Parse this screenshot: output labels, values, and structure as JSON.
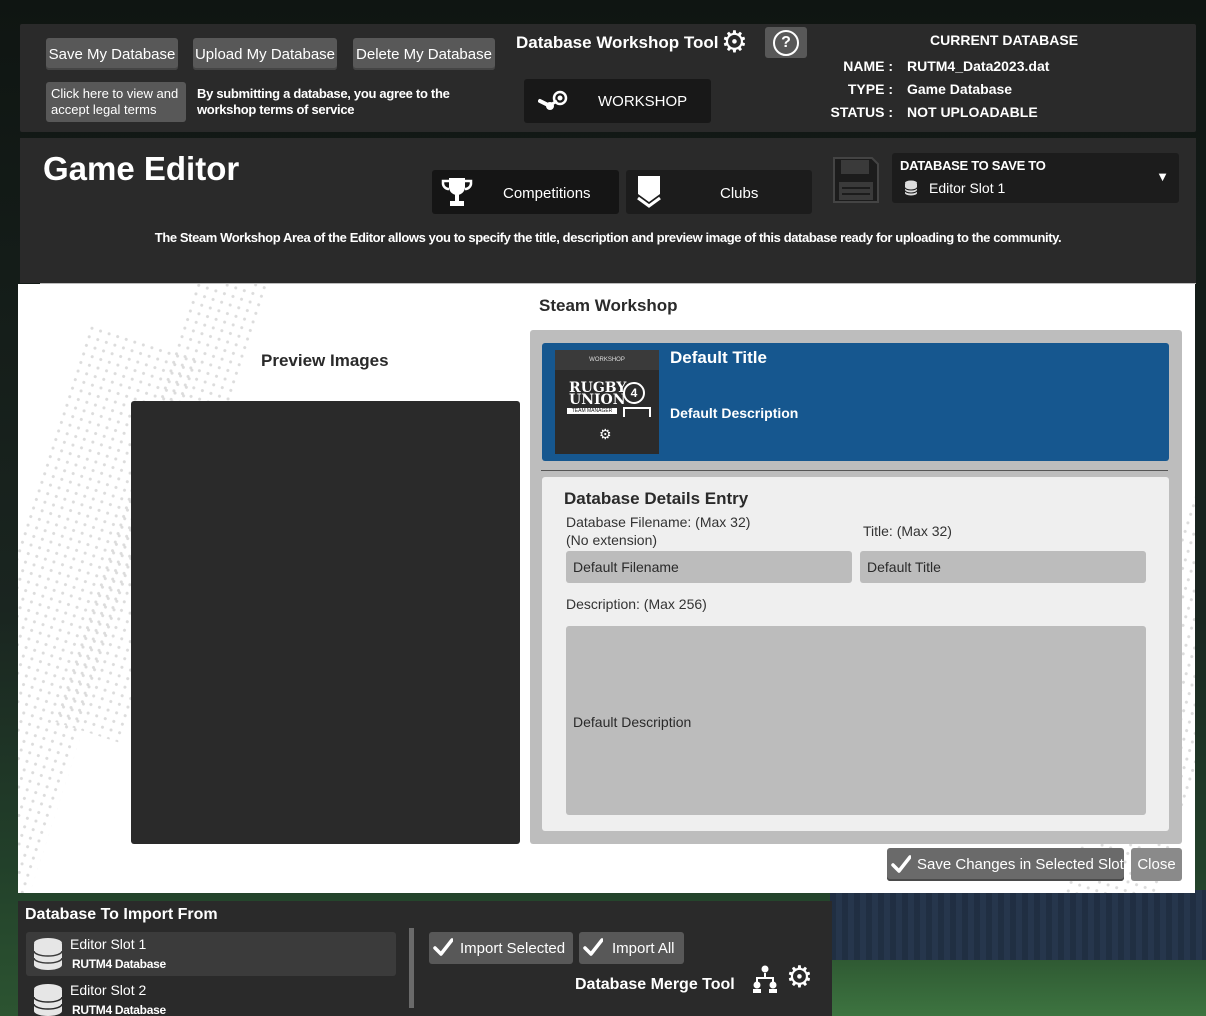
{
  "toolbar": {
    "save_label": "Save My Database",
    "upload_label": "Upload My Database",
    "delete_label": "Delete My Database",
    "legal_button": "Click here to view and accept legal terms",
    "legal_note": "By submitting a database, you agree to the workshop terms of service",
    "tool_title": "Database Workshop Tool",
    "help_label": "?",
    "workshop_label": "WORKSHOP"
  },
  "current_db": {
    "heading": "CURRENT DATABASE",
    "name_key": "NAME :",
    "name_val": "RUTM4_Data2023.dat",
    "type_key": "TYPE :",
    "type_val": "Game Database",
    "status_key": "STATUS :",
    "status_val": "NOT UPLOADABLE"
  },
  "header": {
    "title": "Game Editor",
    "tabs": [
      {
        "label": "Competitions",
        "icon": "trophy-icon"
      },
      {
        "label": "Clubs",
        "icon": "shield-icon"
      }
    ],
    "save_to_title": "DATABASE TO SAVE TO",
    "save_to_value": "Editor Slot 1",
    "caret": "▼",
    "description": "The Steam Workshop Area of the Editor allows you to specify the title, description and preview image of this database ready for uploading to the community."
  },
  "workshop": {
    "section_title": "Steam Workshop",
    "preview_title": "Preview Images",
    "card_title": "Default Title",
    "card_desc": "Default Description",
    "thumb_top": "WORKSHOP",
    "thumb_brand_line1": "RUGBY",
    "thumb_brand_line2": "UNION",
    "thumb_number": "4",
    "thumb_sub": "TEAM MANAGER",
    "details_title": "Database Details Entry",
    "filename_label_1": "Database Filename: (Max 32)",
    "filename_label_2": "(No extension)",
    "title_label": "Title: (Max 32)",
    "filename_value": "Default Filename",
    "title_value": "Default Title",
    "desc_label": "Description: (Max 256)",
    "desc_value": "Default Description",
    "save_button": "Save Changes in Selected Slot",
    "close_button": "Close"
  },
  "import": {
    "title": "Database To Import From",
    "slots": [
      {
        "name": "Editor Slot 1",
        "sub": "RUTM4 Database"
      },
      {
        "name": "Editor Slot 2",
        "sub": "RUTM4 Database"
      }
    ],
    "import_selected": "Import Selected",
    "import_all": "Import All",
    "merge_title": "Database Merge Tool"
  },
  "colors": {
    "panel": "#2a2a2a",
    "button": "#585858",
    "card_blue": "#16578f",
    "field": "#bcbcbc"
  }
}
